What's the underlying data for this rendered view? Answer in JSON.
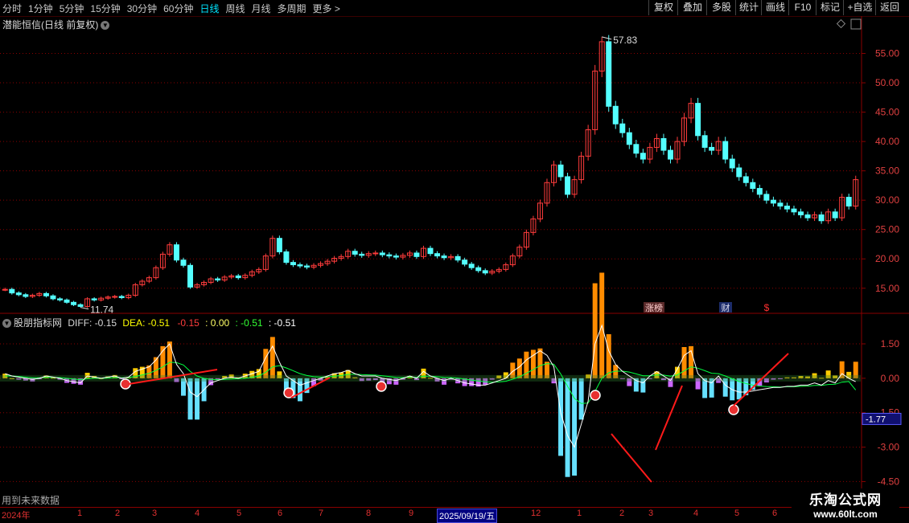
{
  "toolbar": {
    "periods": [
      "分时",
      "1分钟",
      "5分钟",
      "15分钟",
      "30分钟",
      "60分钟",
      "日线",
      "周线",
      "月线",
      "多周期",
      "更多 >"
    ],
    "active_period": "日线",
    "right_buttons": [
      "复权",
      "叠加",
      "多股",
      "统计",
      "画线",
      "F10",
      "标记",
      "+自选",
      "返回"
    ]
  },
  "main_panel": {
    "title": "潜能恒信(日线 前复权)",
    "high_label": "57.83",
    "low_label": "11.74",
    "event_tags": [
      "涨榜",
      "财",
      "$"
    ]
  },
  "indicator_panel": {
    "name": "股朋指标网",
    "diff_label": "DIFF: -0.15",
    "dea_label": "DEA: -0.51",
    "v1": "-0.15",
    "v2": ": 0.00",
    "v3": ": -0.51",
    "v4": ": -0.51",
    "marker": "-1.77",
    "footer": "用到未来数据"
  },
  "time_axis": {
    "year_label": "2024年",
    "months": [
      "1",
      "2",
      "3",
      "4",
      "5",
      "6",
      "7",
      "8",
      "9",
      "12",
      "1",
      "2",
      "3",
      "4",
      "5",
      "6"
    ],
    "cursor_date": "2025/09/19/五"
  },
  "watermark": {
    "line1": "乐淘公式网",
    "line2": "www.60lt.com"
  },
  "colors": {
    "up": "#ff3c3c",
    "down": "#54ffff",
    "diff": "#ffffff",
    "dea": "#ffff00",
    "bg": "#000000"
  },
  "chart_data": [
    {
      "type": "candlestick",
      "title": "潜能恒信(日线 前复权)",
      "y_ticks": [
        "55.00",
        "50.00",
        "45.00",
        "40.00",
        "35.00",
        "30.00",
        "25.00",
        "20.00",
        "15.00"
      ],
      "ylim": [
        11,
        60
      ],
      "close_series": [
        14.8,
        14.2,
        13.9,
        13.6,
        13.8,
        14.1,
        13.7,
        13.2,
        13.0,
        12.6,
        12.2,
        11.9,
        13.2,
        13.0,
        13.3,
        13.5,
        13.6,
        13.4,
        13.8,
        15.6,
        16.2,
        16.8,
        18.5,
        20.8,
        22.4,
        19.8,
        18.9,
        15.2,
        15.6,
        16.0,
        16.6,
        16.4,
        16.9,
        17.1,
        16.8,
        17.2,
        17.8,
        18.2,
        20.5,
        23.5,
        21.2,
        19.4,
        19.0,
        18.8,
        18.6,
        18.9,
        19.2,
        19.6,
        20.1,
        20.4,
        21.3,
        20.8,
        20.6,
        20.9,
        21.0,
        20.7,
        20.5,
        20.3,
        20.6,
        21.0,
        20.4,
        21.8,
        20.9,
        20.5,
        20.2,
        20.4,
        19.8,
        19.1,
        18.5,
        18.0,
        17.6,
        17.9,
        18.2,
        19.0,
        20.5,
        22.0,
        24.5,
        26.8,
        29.5,
        33.0,
        36.0,
        34.0,
        31.0,
        33.5,
        37.5,
        42.0,
        52.0,
        57.0,
        46.0,
        43.0,
        41.5,
        39.5,
        38.0,
        37.0,
        39.0,
        40.5,
        38.5,
        37.0,
        40.0,
        44.0,
        46.5,
        41.0,
        39.0,
        38.5,
        40.0,
        37.0,
        35.5,
        34.0,
        33.0,
        32.0,
        31.0,
        30.0,
        29.5,
        29.0,
        28.5,
        28.0,
        27.5,
        27.0,
        27.5,
        26.5,
        28.0,
        27.0,
        30.5,
        29.0,
        33.5
      ],
      "high": 57.83,
      "low": 11.74
    },
    {
      "type": "bar",
      "title": "股朋指标网",
      "series": [
        {
          "name": "DIFF",
          "values": [
            0.2,
            0.1,
            0.05,
            0,
            -0.05,
            0,
            0.1,
            0.05,
            0,
            -0.1,
            -0.15,
            -0.2,
            0.1,
            0.05,
            0,
            0.05,
            0.1,
            0,
            0.05,
            0.3,
            0.4,
            0.5,
            0.8,
            1.2,
            1.5,
            0.6,
            0.2,
            -0.6,
            -0.8,
            -0.5,
            -0.2,
            -0.1,
            0,
            0.05,
            0,
            0.1,
            0.2,
            0.3,
            0.9,
            1.4,
            0.7,
            0.1,
            -0.1,
            -0.3,
            -0.2,
            -0.1,
            0,
            0.1,
            0.2,
            0.25,
            0.35,
            0.2,
            0.1,
            0.1,
            0.1,
            0,
            -0.05,
            -0.1,
            0,
            0.1,
            0,
            0.3,
            0.1,
            0,
            -0.1,
            0,
            -0.1,
            -0.2,
            -0.25,
            -0.3,
            -0.3,
            -0.2,
            -0.1,
            0,
            0.3,
            0.5,
            0.8,
            1.0,
            1.2,
            1.0,
            0.5,
            -1.5,
            -2.5,
            -3.0,
            -2.0,
            -1.0,
            1.5,
            2.3,
            1.2,
            0.6,
            0.3,
            0.1,
            -0.1,
            -0.2,
            0.1,
            0.3,
            0.1,
            -0.1,
            0.4,
            1.0,
            1.2,
            0.2,
            -0.1,
            -0.2,
            0.1,
            -0.3,
            -0.5,
            -0.6,
            -0.6,
            -0.55,
            -0.5,
            -0.45,
            -0.4,
            -0.4,
            -0.35,
            -0.35,
            -0.3,
            -0.3,
            -0.2,
            -0.3,
            -0.1,
            -0.2,
            0.2,
            0.0,
            -0.15
          ]
        },
        {
          "name": "DEA",
          "values": [
            0.1,
            0.1,
            0.08,
            0.05,
            0.02,
            0.02,
            0.04,
            0.04,
            0.03,
            0,
            -0.03,
            -0.06,
            -0.02,
            0,
            0,
            0.01,
            0.03,
            0.02,
            0.03,
            0.08,
            0.15,
            0.22,
            0.34,
            0.5,
            0.7,
            0.68,
            0.58,
            0.3,
            0.1,
            0,
            -0.05,
            -0.06,
            -0.05,
            -0.03,
            -0.02,
            0,
            0.04,
            0.1,
            0.26,
            0.5,
            0.55,
            0.45,
            0.33,
            0.2,
            0.12,
            0.07,
            0.05,
            0.06,
            0.09,
            0.12,
            0.17,
            0.18,
            0.16,
            0.15,
            0.14,
            0.11,
            0.08,
            0.04,
            0.03,
            0.05,
            0.04,
            0.09,
            0.09,
            0.07,
            0.04,
            0.03,
            0.01,
            -0.03,
            -0.08,
            -0.12,
            -0.16,
            -0.17,
            -0.16,
            -0.13,
            -0.04,
            0.07,
            0.22,
            0.38,
            0.55,
            0.64,
            0.61,
            0.19,
            -0.35,
            -0.88,
            -1.1,
            -1.08,
            -0.57,
            0.0,
            0.24,
            0.31,
            0.31,
            0.27,
            0.19,
            0.11,
            0.11,
            0.15,
            0.14,
            0.09,
            0.15,
            0.32,
            0.5,
            0.44,
            0.33,
            0.22,
            0.2,
            0.1,
            -0.02,
            -0.14,
            -0.23,
            -0.3,
            -0.34,
            -0.36,
            -0.37,
            -0.38,
            -0.37,
            -0.37,
            -0.35,
            -0.34,
            -0.31,
            -0.31,
            -0.27,
            -0.26,
            -0.17,
            -0.14,
            -0.51
          ]
        }
      ],
      "y_ticks": [
        "1.50",
        "0.00",
        "-1.50",
        "-3.00",
        "-4.50"
      ],
      "ylim": [
        -5.5,
        2.2
      ]
    }
  ]
}
